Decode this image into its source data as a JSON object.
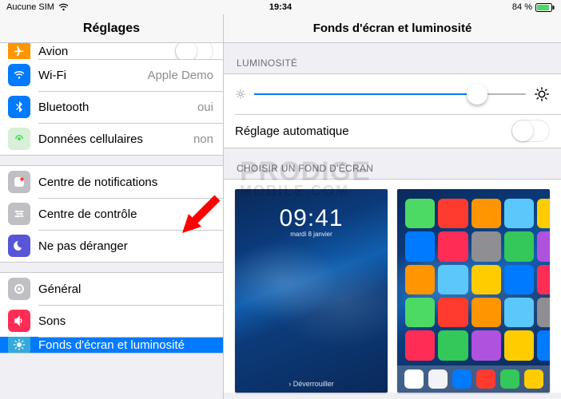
{
  "status": {
    "carrier": "Aucune SIM",
    "time": "19:34",
    "battery_pct": "84 %"
  },
  "sidebar": {
    "title": "Réglages",
    "groups": [
      {
        "items": [
          {
            "key": "airplane",
            "label": "Avion"
          },
          {
            "key": "wifi",
            "label": "Wi-Fi",
            "value": "Apple Demo"
          },
          {
            "key": "bluetooth",
            "label": "Bluetooth",
            "value": "oui"
          },
          {
            "key": "cellular",
            "label": "Données cellulaires",
            "value": "non"
          }
        ]
      },
      {
        "items": [
          {
            "key": "notif",
            "label": "Centre de notifications"
          },
          {
            "key": "ccenter",
            "label": "Centre de contrôle"
          },
          {
            "key": "dnd",
            "label": "Ne pas déranger"
          }
        ]
      },
      {
        "items": [
          {
            "key": "general",
            "label": "Général"
          },
          {
            "key": "sounds",
            "label": "Sons"
          },
          {
            "key": "wallpaper",
            "label": "Fonds d'écran et luminosité"
          }
        ]
      }
    ]
  },
  "detail": {
    "title": "Fonds d'écran et luminosité",
    "brightness_label": "LUMINOSITÉ",
    "auto_label": "Réglage automatique",
    "brightness_pct": 82,
    "choose_label": "CHOISIR UN FOND D'ÉCRAN",
    "lock_preview": {
      "time": "09:41",
      "date": "mardi 8 janvier",
      "slide": "› Déverrouiller"
    }
  },
  "watermark": {
    "line1": "PRODIGE",
    "line2": "MOBILE.COM"
  },
  "app_colors": [
    "#4cd964",
    "#ff3b30",
    "#ff9500",
    "#5ac8fa",
    "#ffcc00",
    "#007aff",
    "#ff2d55",
    "#8e8e93",
    "#34c759",
    "#af52de",
    "#ff9500",
    "#5ac8fa",
    "#ffcc00",
    "#007aff",
    "#ff2d55",
    "#4cd964",
    "#ff3b30",
    "#ff9500",
    "#5ac8fa",
    "#8e8e93",
    "#ff2d55",
    "#34c759",
    "#af52de",
    "#ffcc00",
    "#007aff"
  ],
  "dock_colors": [
    "#ffffff",
    "#f2f2f7",
    "#007aff",
    "#ff3b30",
    "#34c759",
    "#ffcc00"
  ]
}
